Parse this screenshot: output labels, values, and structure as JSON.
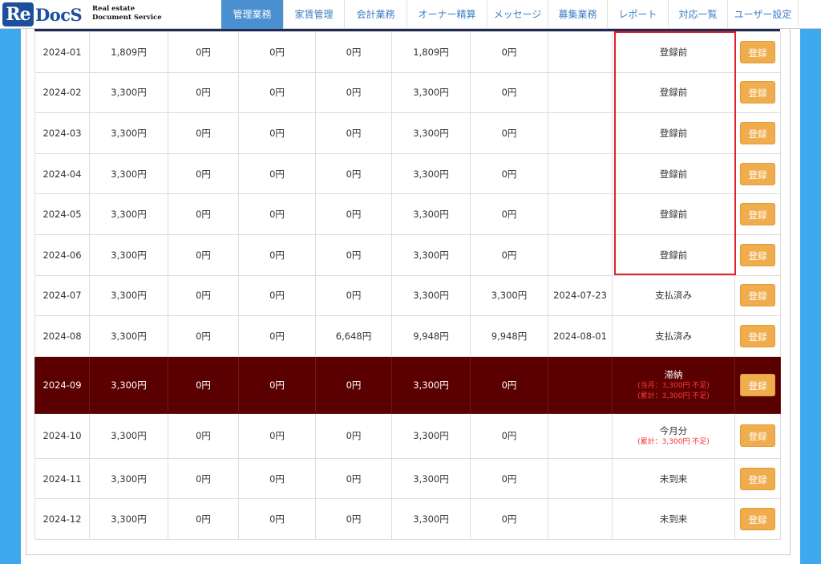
{
  "logo": {
    "re": "Re",
    "docs": "DocS",
    "sub_line1": "Real estate",
    "sub_line2": "Document Service"
  },
  "nav": [
    {
      "label": "管理業務",
      "active": true
    },
    {
      "label": "家賃管理"
    },
    {
      "label": "会計業務"
    },
    {
      "label": "オーナー精算"
    },
    {
      "label": "メッセージ"
    },
    {
      "label": "募集業務"
    },
    {
      "label": "レポート"
    },
    {
      "label": "対応一覧"
    },
    {
      "label": "ユーザー設定"
    }
  ],
  "button_label": "登録",
  "rows": [
    {
      "month": "2024-01",
      "c1": "1,809円",
      "c2": "0円",
      "c3": "0円",
      "c4": "0円",
      "c5": "1,809円",
      "c6": "0円",
      "date": "",
      "status": "登録前",
      "note1": "",
      "note2": ""
    },
    {
      "month": "2024-02",
      "c1": "3,300円",
      "c2": "0円",
      "c3": "0円",
      "c4": "0円",
      "c5": "3,300円",
      "c6": "0円",
      "date": "",
      "status": "登録前",
      "note1": "",
      "note2": ""
    },
    {
      "month": "2024-03",
      "c1": "3,300円",
      "c2": "0円",
      "c3": "0円",
      "c4": "0円",
      "c5": "3,300円",
      "c6": "0円",
      "date": "",
      "status": "登録前",
      "note1": "",
      "note2": ""
    },
    {
      "month": "2024-04",
      "c1": "3,300円",
      "c2": "0円",
      "c3": "0円",
      "c4": "0円",
      "c5": "3,300円",
      "c6": "0円",
      "date": "",
      "status": "登録前",
      "note1": "",
      "note2": ""
    },
    {
      "month": "2024-05",
      "c1": "3,300円",
      "c2": "0円",
      "c3": "0円",
      "c4": "0円",
      "c5": "3,300円",
      "c6": "0円",
      "date": "",
      "status": "登録前",
      "note1": "",
      "note2": ""
    },
    {
      "month": "2024-06",
      "c1": "3,300円",
      "c2": "0円",
      "c3": "0円",
      "c4": "0円",
      "c5": "3,300円",
      "c6": "0円",
      "date": "",
      "status": "登録前",
      "note1": "",
      "note2": ""
    },
    {
      "month": "2024-07",
      "c1": "3,300円",
      "c2": "0円",
      "c3": "0円",
      "c4": "0円",
      "c5": "3,300円",
      "c6": "3,300円",
      "date": "2024-07-23",
      "status": "支払済み",
      "note1": "",
      "note2": ""
    },
    {
      "month": "2024-08",
      "c1": "3,300円",
      "c2": "0円",
      "c3": "0円",
      "c4": "6,648円",
      "c5": "9,948円",
      "c6": "9,948円",
      "date": "2024-08-01",
      "status": "支払済み",
      "note1": "",
      "note2": ""
    },
    {
      "month": "2024-09",
      "c1": "3,300円",
      "c2": "0円",
      "c3": "0円",
      "c4": "0円",
      "c5": "3,300円",
      "c6": "0円",
      "date": "",
      "status": "滞納",
      "note1": "(当月：3,300円 不足)",
      "note2": "(累計：3,300円 不足)",
      "overdue": true
    },
    {
      "month": "2024-10",
      "c1": "3,300円",
      "c2": "0円",
      "c3": "0円",
      "c4": "0円",
      "c5": "3,300円",
      "c6": "0円",
      "date": "",
      "status": "今月分",
      "note1": "(累計：3,300円 不足)",
      "note2": ""
    },
    {
      "month": "2024-11",
      "c1": "3,300円",
      "c2": "0円",
      "c3": "0円",
      "c4": "0円",
      "c5": "3,300円",
      "c6": "0円",
      "date": "",
      "status": "未到来",
      "note1": "",
      "note2": ""
    },
    {
      "month": "2024-12",
      "c1": "3,300円",
      "c2": "0円",
      "c3": "0円",
      "c4": "0円",
      "c5": "3,300円",
      "c6": "0円",
      "date": "",
      "status": "未到来",
      "note1": "",
      "note2": ""
    }
  ]
}
